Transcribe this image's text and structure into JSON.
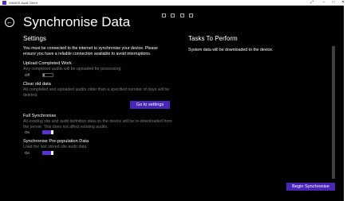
{
  "window": {
    "title": "SAMOS Audit Client"
  },
  "page": {
    "title": "Synchronise Data"
  },
  "settings": {
    "heading": "Settings",
    "intro": "You must be connected to the internet to synchronise your device. Please ensure you have a reliable connection available to avoid interruptions.",
    "upload": {
      "label": "Upload Completed Work",
      "description": "Any completed audits will be uploaded for processing.",
      "toggle_state": "Off"
    },
    "clear": {
      "label": "Clear old data",
      "description": "All completed and uploaded audits older than a specified number of days will be deleted.",
      "button_label": "Go to settings"
    },
    "full": {
      "label": "Full Synchronise",
      "description": "All existing site and audit definition data on the device will be re-downloaded from the server. This does not affect existing audits.",
      "toggle_state": "On"
    },
    "prepop": {
      "label": "Synchronise Pre-population Data",
      "description": "Load the last stored site audit data.",
      "toggle_state": "On"
    }
  },
  "tasks": {
    "heading": "Tasks To Perform",
    "items": [
      "System data will be downloaded to the device."
    ]
  },
  "actions": {
    "begin_label": "Begin Synchronise"
  },
  "colors": {
    "accent": "#4a26b8",
    "toggle_on": "#5b2fcf",
    "background": "#000000"
  }
}
